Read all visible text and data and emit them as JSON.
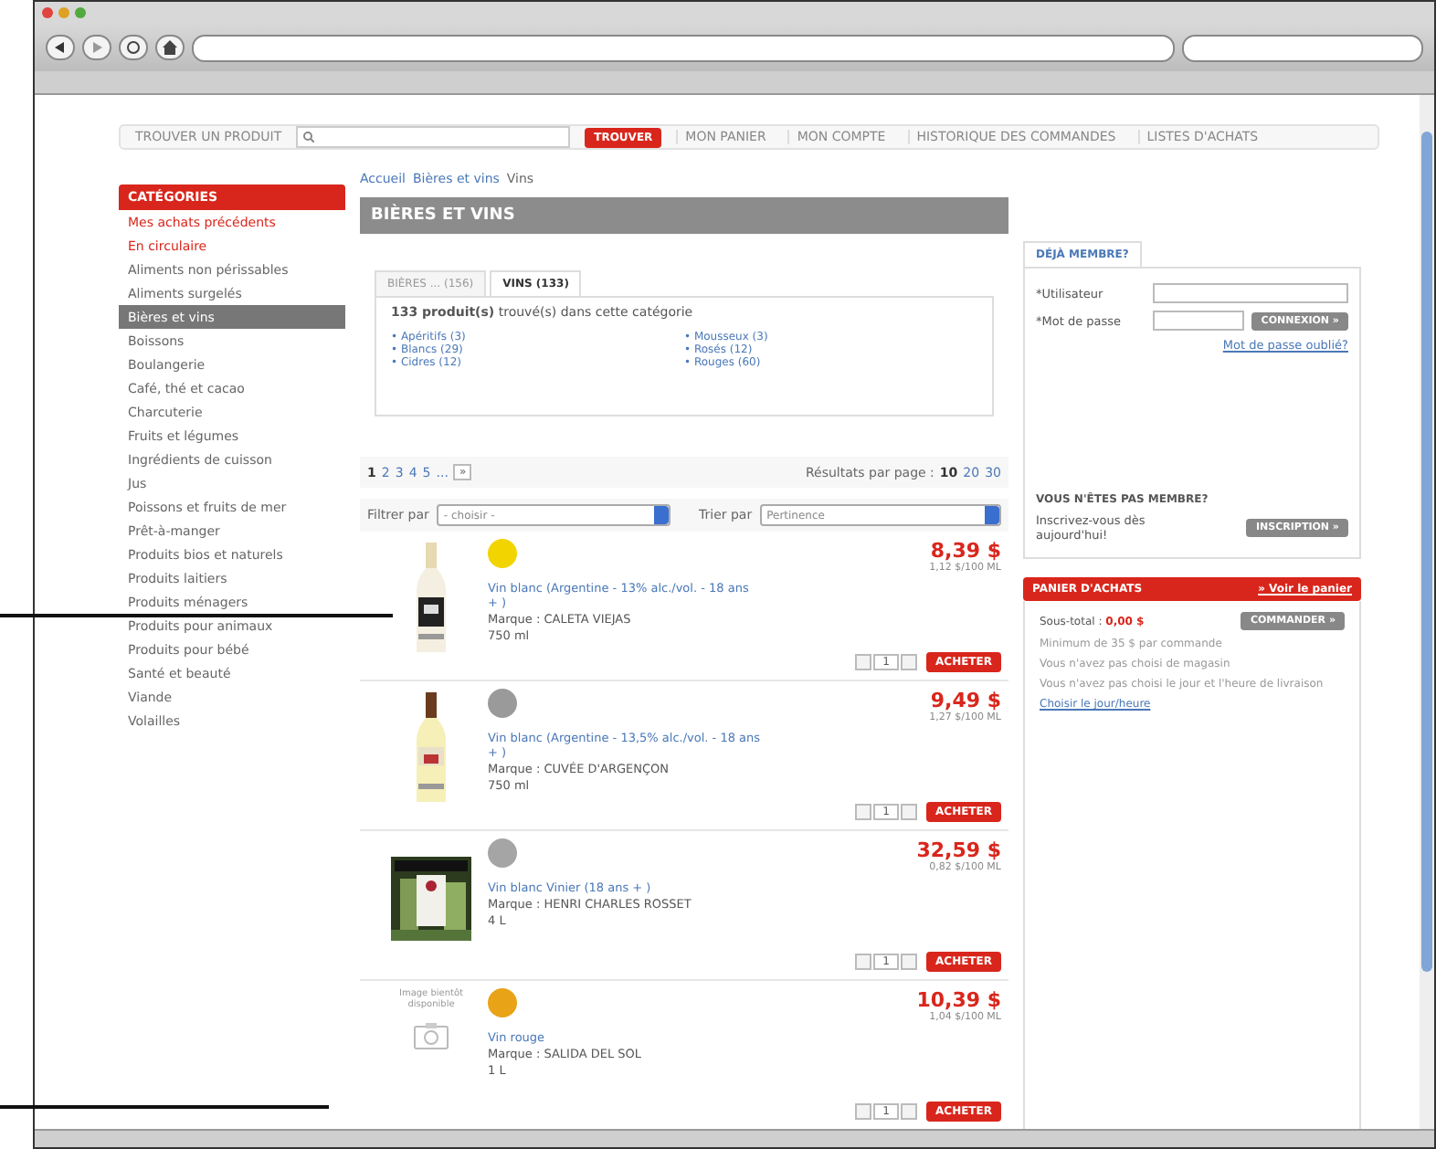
{
  "nav": {
    "search_label": "TROUVER UN PRODUIT",
    "search_button": "TROUVER",
    "links": [
      "MON PANIER",
      "MON COMPTE",
      "HISTORIQUE DES COMMANDES",
      "LISTES D'ACHATS"
    ]
  },
  "categories": {
    "title": "CATÉGORIES",
    "items": [
      {
        "label": "Mes achats précédents",
        "kind": "promo",
        "selected": false
      },
      {
        "label": "En circulaire",
        "kind": "promo",
        "selected": false
      },
      {
        "label": "Aliments non périssables",
        "kind": "normal",
        "selected": false
      },
      {
        "label": "Aliments surgelés",
        "kind": "normal",
        "selected": false
      },
      {
        "label": "Bières et vins",
        "kind": "normal",
        "selected": true
      },
      {
        "label": "Boissons",
        "kind": "normal",
        "selected": false
      },
      {
        "label": "Boulangerie",
        "kind": "normal",
        "selected": false
      },
      {
        "label": "Café, thé et cacao",
        "kind": "normal",
        "selected": false
      },
      {
        "label": "Charcuterie",
        "kind": "normal",
        "selected": false
      },
      {
        "label": "Fruits et légumes",
        "kind": "normal",
        "selected": false
      },
      {
        "label": "Ingrédients de cuisson",
        "kind": "normal",
        "selected": false
      },
      {
        "label": "Jus",
        "kind": "normal",
        "selected": false
      },
      {
        "label": "Poissons et fruits de mer",
        "kind": "normal",
        "selected": false
      },
      {
        "label": "Prêt-à-manger",
        "kind": "normal",
        "selected": false
      },
      {
        "label": "Produits bios et naturels",
        "kind": "normal",
        "selected": false
      },
      {
        "label": "Produits laitiers",
        "kind": "normal",
        "selected": false
      },
      {
        "label": "Produits ménagers",
        "kind": "normal",
        "selected": false
      },
      {
        "label": "Produits pour animaux",
        "kind": "normal",
        "selected": false
      },
      {
        "label": "Produits pour bébé",
        "kind": "normal",
        "selected": false
      },
      {
        "label": "Santé et beauté",
        "kind": "normal",
        "selected": false
      },
      {
        "label": "Viande",
        "kind": "normal",
        "selected": false
      },
      {
        "label": "Volailles",
        "kind": "normal",
        "selected": false
      }
    ]
  },
  "breadcrumb": [
    "Accueil",
    "Bières et vins",
    "Vins"
  ],
  "heading": "BIÈRES ET VINS",
  "tabs": [
    {
      "label": "BIÈRES ... (156)",
      "selected": false
    },
    {
      "label": "VINS (133)",
      "selected": true
    }
  ],
  "summary": "**133 produit(s)** trouvé(s) dans cette catégorie",
  "subcategories": [
    "• Apéritifs (3)",
    "• Blancs (29)",
    "• Cidres (12)",
    "• Mousseux (3)",
    "• Rosés (12)",
    "• Rouges (60)"
  ],
  "pagination": {
    "pages": [
      {
        "label": "1",
        "selected": true
      },
      {
        "label": "2",
        "selected": false
      },
      {
        "label": "3",
        "selected": false
      },
      {
        "label": "4",
        "selected": false
      },
      {
        "label": "5",
        "selected": false
      },
      {
        "label": "...",
        "selected": false
      }
    ],
    "next": "»"
  },
  "per_page": {
    "label": "Résultats par page :",
    "options": [
      {
        "label": "10",
        "selected": true
      },
      {
        "label": "20",
        "selected": false
      },
      {
        "label": "30",
        "selected": false
      }
    ]
  },
  "filter": {
    "label": "Filtrer par",
    "value": "- choisir -"
  },
  "sort": {
    "label": "Trier par",
    "value": "Pertinence"
  },
  "products": [
    {
      "color": "#f2d400",
      "name": "Vin blanc (Argentine - 13% alc./vol. - 18 ans + )",
      "brand": "Marque : CALETA VIEJAS",
      "size": "750 ml",
      "price": "8,39 $",
      "unit_price": "1,12 $/100 ML",
      "quantity": "1",
      "buy": "ACHETER"
    },
    {
      "color": "#9a9a9a",
      "name": "Vin blanc (Argentine - 13,5% alc./vol. - 18 ans + )",
      "brand": "Marque : CUVÉE D'ARGENÇON",
      "size": "750 ml",
      "price": "9,49 $",
      "unit_price": "1,27 $/100 ML",
      "quantity": "1",
      "buy": "ACHETER"
    },
    {
      "color": "#a5a5a5",
      "name": "Vin blanc Vinier (18 ans + )",
      "brand": "Marque : HENRI CHARLES ROSSET",
      "size": "4 L",
      "price": "32,59 $",
      "unit_price": "0,82 $/100 ML",
      "quantity": "1",
      "buy": "ACHETER"
    },
    {
      "image": {
        "kind": "placeholder",
        "text": "Image bientôt disponible"
      },
      "color": "#e8a317",
      "name": "Vin rouge",
      "brand": "Marque : SALIDA DEL SOL",
      "size": "1 L",
      "price": "10,39 $",
      "unit_price": "1,04 $/100 ML",
      "quantity": "1",
      "buy": "ACHETER"
    }
  ],
  "login": {
    "tab": "DÉJÀ MEMBRE?",
    "user_label": "*Utilisateur",
    "password_label": "*Mot de passe",
    "button": "CONNEXION »",
    "forgot": "Mot de passe oublié?",
    "signup_title": "VOUS N'ÊTES PAS MEMBRE?",
    "signup_text": "Inscrivez-vous dès aujourd'hui!",
    "signup_button": "INSCRIPTION »"
  },
  "cart": {
    "title": "PANIER D'ACHATS",
    "view_link": "» Voir le panier",
    "subtotal_label": "Sous-total :",
    "subtotal": "0,00 $",
    "button": "COMMANDER »",
    "notes": [
      "Minimum de 35 $ par commande",
      "Vous n'avez pas choisi de magasin",
      "Vous n'avez pas choisi le jour et l'heure de livraison"
    ],
    "choose_link": "Choisir le jour/heure"
  }
}
